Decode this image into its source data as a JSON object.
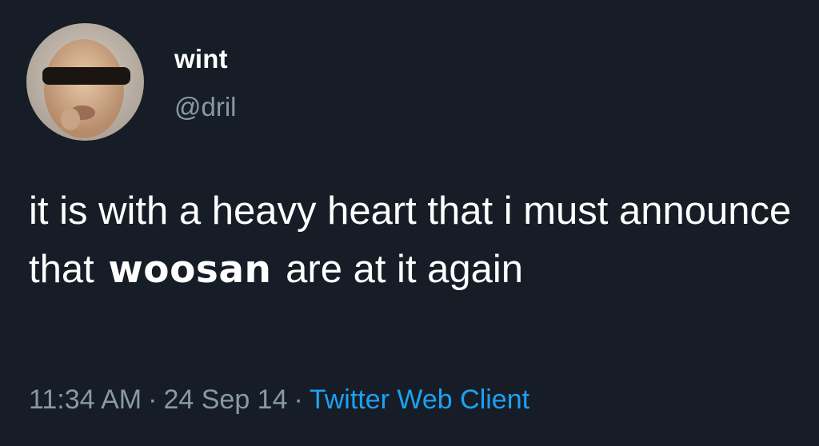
{
  "user": {
    "display_name": "wint",
    "handle": "@dril",
    "avatar_icon": "user-avatar-icon"
  },
  "tweet": {
    "text_part1": "it is with a heavy heart that i must announce that",
    "text_emphasis": "woosan",
    "text_part2": "are at it again"
  },
  "meta": {
    "time": "11:34 AM",
    "separator": "·",
    "date": "24 Sep 14",
    "source": "Twitter Web Client"
  },
  "colors": {
    "background": "#161d27",
    "text": "#ffffff",
    "secondary": "#8899a6",
    "link": "#1da1f2"
  }
}
